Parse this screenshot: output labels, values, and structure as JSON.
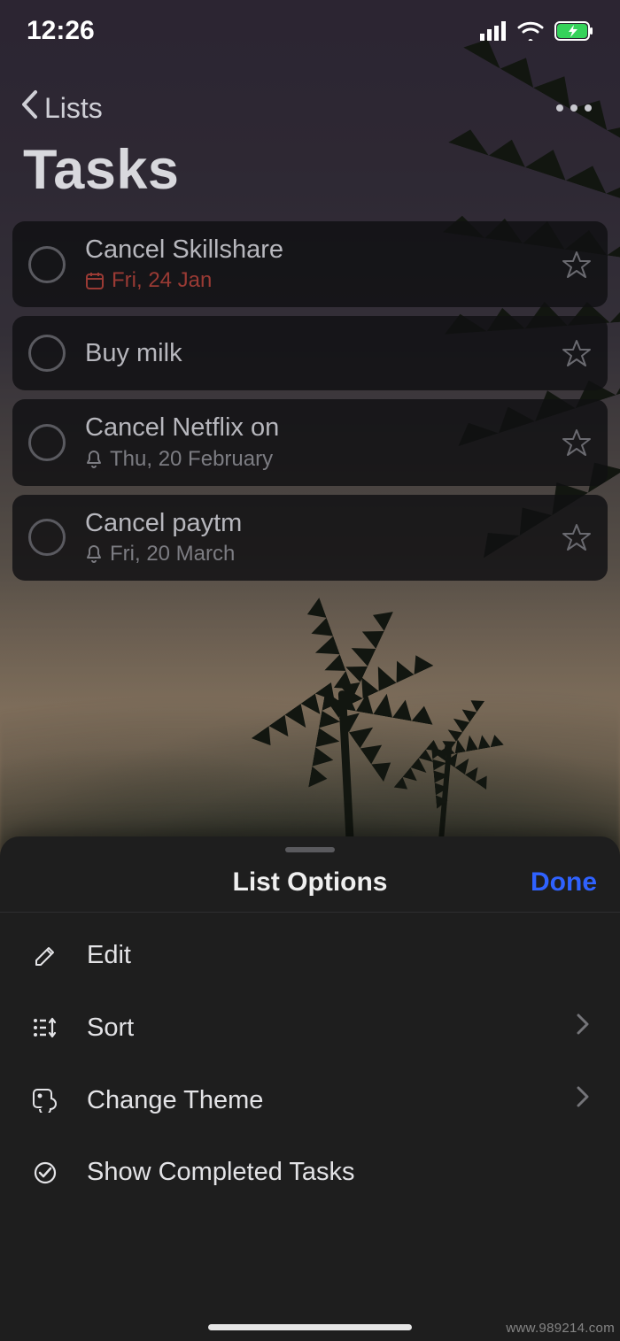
{
  "status": {
    "time": "12:26"
  },
  "nav": {
    "back_label": "Lists"
  },
  "page": {
    "title": "Tasks"
  },
  "tasks": [
    {
      "title": "Cancel Skillshare",
      "date": "Fri, 24 Jan",
      "overdue": true,
      "icon": "calendar"
    },
    {
      "title": "Buy milk",
      "date": "",
      "overdue": false,
      "icon": ""
    },
    {
      "title": "Cancel Netflix on",
      "date": "Thu, 20 February",
      "overdue": false,
      "icon": "bell"
    },
    {
      "title": "Cancel paytm",
      "date": "Fri, 20 March",
      "overdue": false,
      "icon": "bell"
    }
  ],
  "sheet": {
    "title": "List Options",
    "done_label": "Done",
    "items": [
      {
        "icon": "pencil",
        "label": "Edit",
        "chevron": false
      },
      {
        "icon": "sort",
        "label": "Sort",
        "chevron": true
      },
      {
        "icon": "theme",
        "label": "Change Theme",
        "chevron": true
      },
      {
        "icon": "check",
        "label": "Show Completed Tasks",
        "chevron": false
      }
    ]
  },
  "watermark": "www.989214.com"
}
